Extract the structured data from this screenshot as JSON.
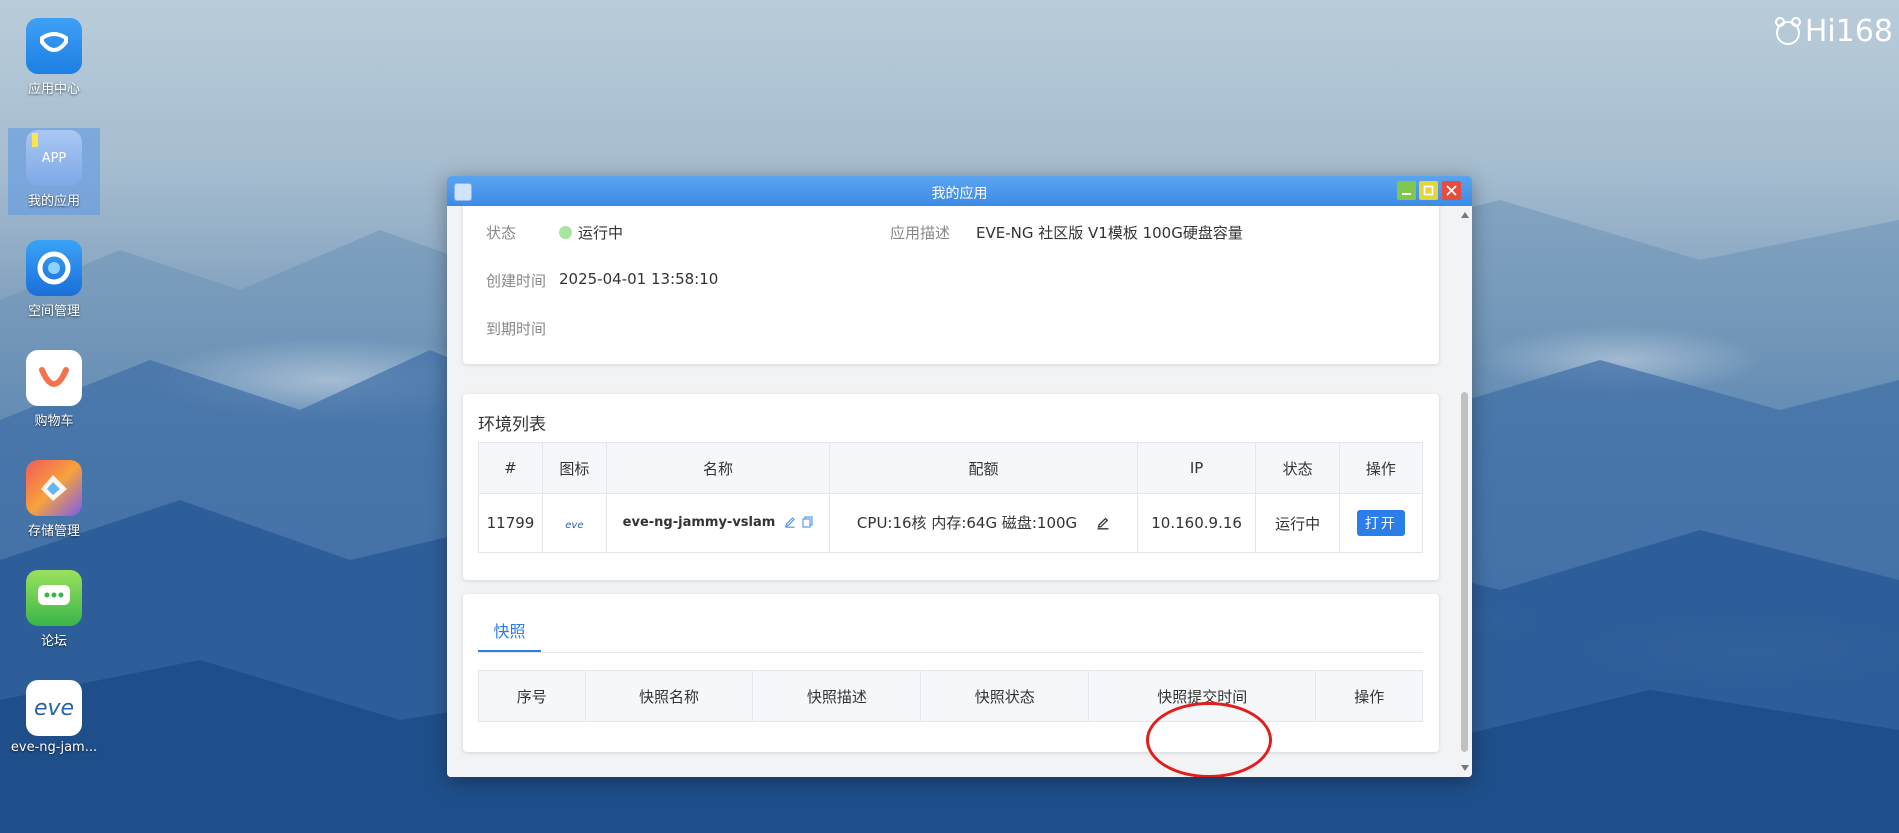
{
  "brand": {
    "text": "Hi168"
  },
  "desktop": {
    "icons": [
      {
        "label": "应用中心",
        "icon": "app-center-icon"
      },
      {
        "label": "我的应用",
        "icon": "app-icon",
        "badge": "APP"
      },
      {
        "label": "空间管理",
        "icon": "space-icon"
      },
      {
        "label": "购物车",
        "icon": "cart-icon"
      },
      {
        "label": "存储管理",
        "icon": "storage-icon"
      },
      {
        "label": "论坛",
        "icon": "forum-icon"
      },
      {
        "label": "eve-ng-jam...",
        "icon": "eve-ng-icon",
        "logo_text": "eve"
      }
    ]
  },
  "window": {
    "title": "我的应用",
    "info": {
      "status_label": "状态",
      "status_value": "运行中",
      "desc_label": "应用描述",
      "desc_value": "EVE-NG 社区版 V1模板 100G硬盘容量",
      "created_label": "创建时间",
      "created_value": "2025-04-01 13:58:10",
      "expire_label": "到期时间",
      "expire_value": ""
    },
    "env": {
      "title": "环境列表",
      "columns": [
        "#",
        "图标",
        "名称",
        "配额",
        "IP",
        "状态",
        "操作"
      ],
      "rows": [
        {
          "id": "11799",
          "icon_text": "eve",
          "name": "eve-ng-jammy-vslam",
          "quota": "CPU:16核 内存:64G 磁盘:100G",
          "ip": "10.160.9.16",
          "status": "运行中",
          "action": "打开"
        }
      ]
    },
    "snapshot": {
      "tab": "快照",
      "columns": [
        "序号",
        "快照名称",
        "快照描述",
        "快照状态",
        "快照提交时间",
        "操作"
      ]
    }
  },
  "colors": {
    "accent": "#2b7de9",
    "titlebar": "#3d8be6",
    "highlight_circle": "#e31c1c",
    "status_dot": "#a8e6a0"
  }
}
